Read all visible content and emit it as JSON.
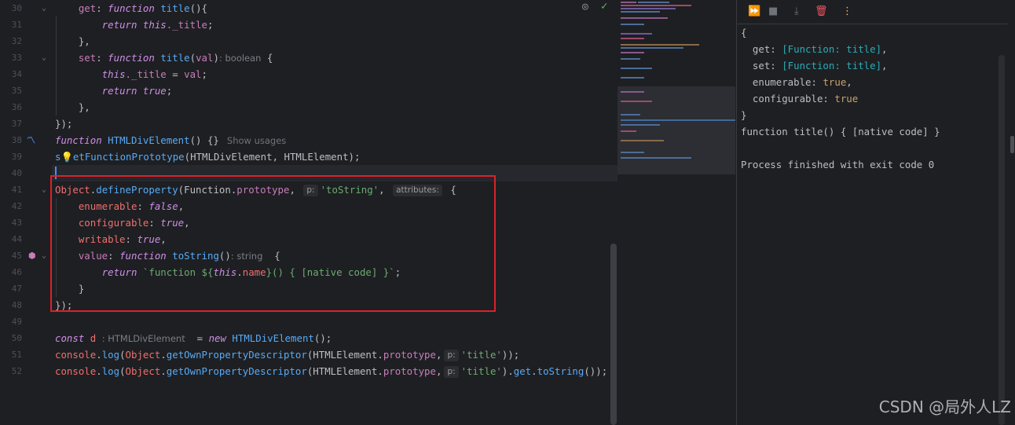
{
  "gutter": {
    "line_numbers": [
      "30",
      "31",
      "32",
      "33",
      "34",
      "35",
      "36",
      "37",
      "38",
      "39",
      "40",
      "41",
      "42",
      "43",
      "44",
      "45",
      "46",
      "47",
      "48",
      "49",
      "50",
      "51",
      "52"
    ]
  },
  "code": {
    "l30": {
      "get": "get",
      "colon": ": ",
      "function": "function",
      "name": "title",
      "rest": "(){"
    },
    "l31": {
      "return": "return",
      "this": "this",
      "prop": "._title",
      "semi": ";"
    },
    "l32": {
      "text": "},"
    },
    "l33": {
      "set": "set",
      "colon": ": ",
      "function": "function",
      "name": "title",
      "open": "(",
      "param": "val",
      "close": ")",
      "type_hint": ": boolean",
      "brace": " {"
    },
    "l34": {
      "this": "this",
      "prop": "._title",
      "eq": " = ",
      "val": "val",
      "semi": ";"
    },
    "l35": {
      "return": "return",
      "value": "true",
      "semi": ";"
    },
    "l36": {
      "text": "},"
    },
    "l37": {
      "text": "});"
    },
    "l38": {
      "function": "function",
      "name": "HTMLDivElement",
      "rest": "() {}",
      "usages": "Show usages"
    },
    "l39": {
      "prefix": "s",
      "mid": "etFunctionPrototype",
      "open": "(",
      "a1": "HTMLDivElement",
      "comma": ", ",
      "a2": "HTMLElement",
      "close": ");"
    },
    "l41": {
      "obj": "Object",
      "dot": ".",
      "method": "defineProperty",
      "open": "(",
      "a1": "Function",
      "dot2": ".",
      "a1b": "prototype",
      "comma": ", ",
      "hint_p": "p:",
      "str": "'toString'",
      "comma2": ", ",
      "hint_attr": "attributes:",
      "brace": " {"
    },
    "l42": {
      "key": "enumerable",
      "colon": ": ",
      "val": "false",
      "comma": ","
    },
    "l43": {
      "key": "configurable",
      "colon": ": ",
      "val": "true",
      "comma": ","
    },
    "l44": {
      "key": "writable",
      "colon": ": ",
      "val": "true",
      "comma": ","
    },
    "l45": {
      "key": "value",
      "colon": ": ",
      "function": "function",
      "name": "toString",
      "rest": "()",
      "type_hint": ": string",
      "brace": "  {"
    },
    "l46": {
      "return": "return",
      "tpl1": " `function ${",
      "this": "this",
      "dot": ".",
      "name": "name",
      "tpl2": "}() { [native code] }`",
      "semi": ";"
    },
    "l47": {
      "text": "}"
    },
    "l48": {
      "text": "});"
    },
    "l50": {
      "const": "const",
      "var": "d",
      "type_hint": ": HTMLDivElement",
      "eq": "  = ",
      "new": "new",
      "cls": "HTMLDivElement",
      "rest": "();"
    },
    "l51": {
      "console": "console",
      "dot": ".",
      "log": "log",
      "open": "(",
      "obj": "Object",
      "dot2": ".",
      "method": "getOwnPropertyDescriptor",
      "open2": "(",
      "cls": "HTMLElement",
      "dot3": ".",
      "proto": "prototype",
      "comma": ",",
      "hint_p": "p:",
      "str": "'title'",
      "close": "));"
    },
    "l52": {
      "console": "console",
      "dot": ".",
      "log": "log",
      "open": "(",
      "obj": "Object",
      "dot2": ".",
      "method": "getOwnPropertyDescriptor",
      "open2": "(",
      "cls": "HTMLElement",
      "dot3": ".",
      "proto": "prototype",
      "comma": ",",
      "hint_p": "p:",
      "str": "'title'",
      "close": ").",
      "get": "get",
      "dot4": ".",
      "tostr": "toString",
      "end": "());"
    }
  },
  "output": {
    "l1": "{",
    "l2": {
      "key": "  get: ",
      "val": "[Function: title]",
      "comma": ","
    },
    "l3": {
      "key": "  set: ",
      "val": "[Function: title]",
      "comma": ","
    },
    "l4": {
      "key": "  enumerable: ",
      "val": "true",
      "comma": ","
    },
    "l5": {
      "key": "  configurable: ",
      "val": "true"
    },
    "l6": "}",
    "l7": "function title() { [native code] }",
    "l8": "Process finished with exit code 0"
  },
  "watermark": "CSDN @局外人LZ",
  "colors": {
    "highlight_box": "#d9222a",
    "accent": "#4d8cff"
  },
  "icons": [
    "reader-mode-off-icon",
    "checkmark-icon",
    "rerun-icon",
    "stop-icon",
    "scroll-to-end-icon",
    "clear-all-icon",
    "more-options-icon",
    "edit-icon",
    "lightbulb-icon",
    "override-icon"
  ]
}
